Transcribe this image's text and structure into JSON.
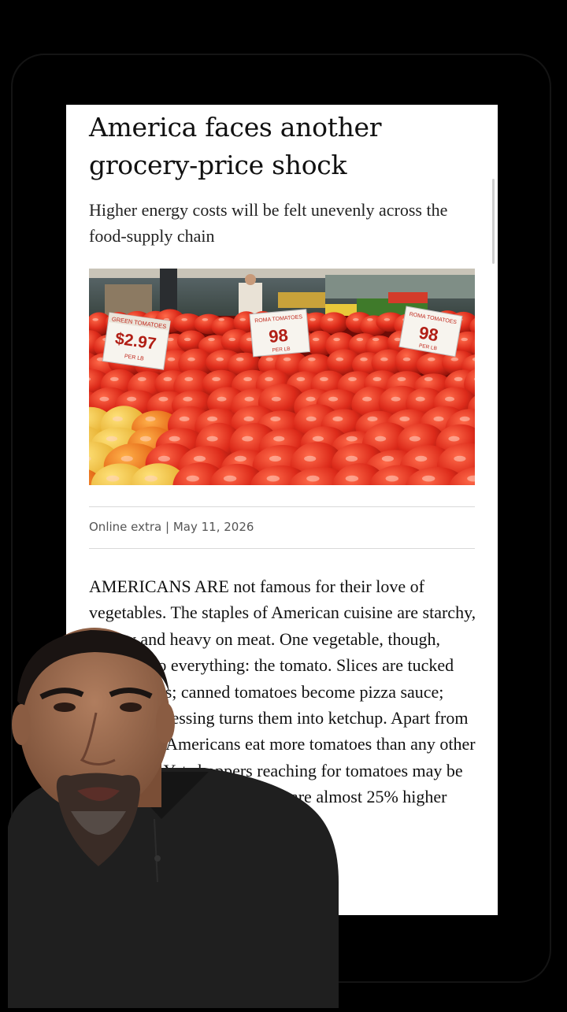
{
  "article": {
    "headline": "America faces another grocery-price shock",
    "subheadline": "Higher energy costs will be felt unevenly across the food-supply chain",
    "section": "Online extra",
    "separator": "|",
    "date": "May 11, 2026",
    "body": "AMERICANS ARE not famous for their love of vegetables. The staples of American cuisine are starchy, cheesy and heavy on meat. One vegetable, though, sneaks into everything: the tomato. Slices are tucked into burgers; canned tomatoes become pizza sauce; further processing turns them into ketchup. Apart from the potato, Americans eat more tomatoes than any other vegetable. Yet shoppers reaching for tomatoes may be experiencing a shock. Prices are almost 25% higher than a year ago. It is eggs all"
  },
  "photo": {
    "signs": [
      {
        "title": "GREEN TOMATOES",
        "price": "$2.97",
        "unit": "PER LB"
      },
      {
        "title": "ROMA TOMATOES",
        "price": "98",
        "unit": "PER LB"
      },
      {
        "title": "ROMA TOMATOES",
        "price": "98",
        "unit": "PER LB"
      }
    ]
  },
  "colors": {
    "page_background": "#000000",
    "card_background": "#ffffff",
    "text": "#111111",
    "tomato_red": "#d8281c",
    "shirt": "#1f1f1f"
  }
}
